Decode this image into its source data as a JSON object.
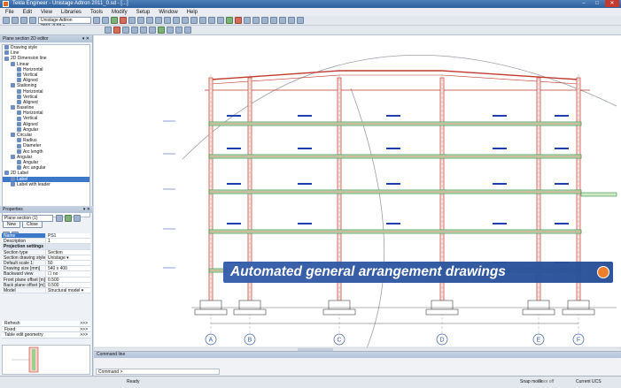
{
  "window": {
    "title": "Tekla Engineer - Unistage Adtron 2011_0.sd - [...]",
    "controls": [
      "–",
      "□",
      "✕"
    ]
  },
  "menu": [
    "File",
    "Edit",
    "View",
    "Libraries",
    "Tools",
    "Modify",
    "Setup",
    "Window",
    "Help"
  ],
  "toolbar": {
    "model_combo": "Unistage Adtron 2011_0.03 ▾"
  },
  "left_panel": {
    "title": "Plane section 2D editor",
    "tree": [
      {
        "label": "Drawing style",
        "indent": 1
      },
      {
        "label": "Line",
        "indent": 1
      },
      {
        "label": "2D Dimension line",
        "indent": 1
      },
      {
        "label": "Linear",
        "indent": 2
      },
      {
        "label": "Horizontal",
        "indent": 3
      },
      {
        "label": "Vertical",
        "indent": 3
      },
      {
        "label": "Aligned",
        "indent": 3
      },
      {
        "label": "Stationing",
        "indent": 2
      },
      {
        "label": "Horizontal",
        "indent": 3
      },
      {
        "label": "Vertical",
        "indent": 3
      },
      {
        "label": "Aligned",
        "indent": 3
      },
      {
        "label": "Baseline",
        "indent": 2
      },
      {
        "label": "Horizontal",
        "indent": 3
      },
      {
        "label": "Vertical",
        "indent": 3
      },
      {
        "label": "Aligned",
        "indent": 3
      },
      {
        "label": "Angular",
        "indent": 3
      },
      {
        "label": "Circular",
        "indent": 2
      },
      {
        "label": "Radius",
        "indent": 3
      },
      {
        "label": "Diameter",
        "indent": 3
      },
      {
        "label": "Arc length",
        "indent": 3
      },
      {
        "label": "Angular",
        "indent": 2
      },
      {
        "label": "Angular",
        "indent": 3
      },
      {
        "label": "Arc angular",
        "indent": 3
      },
      {
        "label": "2D Label",
        "indent": 1
      },
      {
        "label": "Label",
        "indent": 2,
        "selected": true
      },
      {
        "label": "Label with leader",
        "indent": 2
      }
    ],
    "buttons": {
      "new": "New",
      "close": "Close"
    }
  },
  "properties": {
    "title": "Properties",
    "selector": "Plane section (1)",
    "rows": [
      {
        "k": "Name",
        "v": "PS1",
        "type": "sel"
      },
      {
        "k": "Description",
        "v": "1"
      },
      {
        "k": "Projection settings",
        "v": "",
        "type": "grp"
      },
      {
        "k": "Section type",
        "v": "Section"
      },
      {
        "k": "Section drawing style",
        "v": "Unistage ▾"
      },
      {
        "k": "Default scale 1:",
        "v": "50"
      },
      {
        "k": "Drawing size [mm]",
        "v": "540 x 400"
      },
      {
        "k": "Backward view",
        "v": "☐ no"
      },
      {
        "k": "Front plane offset [m]",
        "v": "0.500"
      },
      {
        "k": "Back plane offset [m]",
        "v": "0.500"
      },
      {
        "k": "Model",
        "v": "Structural model ▾"
      }
    ],
    "actions": [
      {
        "label": "Refresh",
        "more": ">>>"
      },
      {
        "label": "Fixed",
        "more": ">>>"
      },
      {
        "label": "Table edit geometry",
        "more": ">>>"
      }
    ]
  },
  "canvas": {
    "grid_labels": [
      "A",
      "B",
      "C",
      "D",
      "E",
      "F"
    ],
    "tabs_label": "Section"
  },
  "command_line": {
    "title": "Command line",
    "prompt": "Command >"
  },
  "status": {
    "ready": "Ready",
    "snap": "Snap mode",
    "floor": "Floor off",
    "ucs": "Current UCS"
  },
  "banner": {
    "text": "Automated general arrangement drawings",
    "bg": "#345daa",
    "dot": "#ee7f2a"
  },
  "colors": {
    "column": "#c0392b",
    "beam": "#2e8b3d",
    "dim_text": "#1f3fb0"
  }
}
